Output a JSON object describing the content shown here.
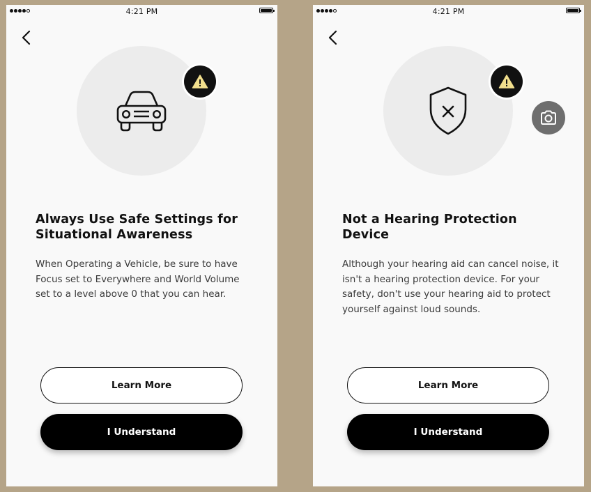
{
  "screens": [
    {
      "status": {
        "time": "4:21 PM"
      },
      "title": "Always Use Safe Settings for Situational Awareness",
      "body": "When Operating a Vehicle, be sure to have Focus set to Everywhere and World Volume set to a level above 0 that you can hear.",
      "hero_icon": "car-icon",
      "badge_icon": "warning-icon",
      "buttons": {
        "learn_more": "Learn More",
        "understand": "I Understand"
      }
    },
    {
      "status": {
        "time": "4:21 PM"
      },
      "title": "Not a Hearing Protection Device",
      "body": "Although your hearing aid can cancel noise, it isn't a hearing protection device. For your safety, don't use your hearing aid to protect yourself against loud sounds.",
      "hero_icon": "shield-x-icon",
      "badge_icon": "warning-icon",
      "extra_icon": "camera-icon",
      "buttons": {
        "learn_more": "Learn More",
        "understand": "I Understand"
      }
    }
  ],
  "colors": {
    "background": "#b5a488",
    "screen": "#f9f9f9",
    "hero_circle": "#ececec",
    "warning_yellow": "#f2df8d",
    "primary_button": "#000000",
    "camera_button": "#6e6e6e"
  }
}
